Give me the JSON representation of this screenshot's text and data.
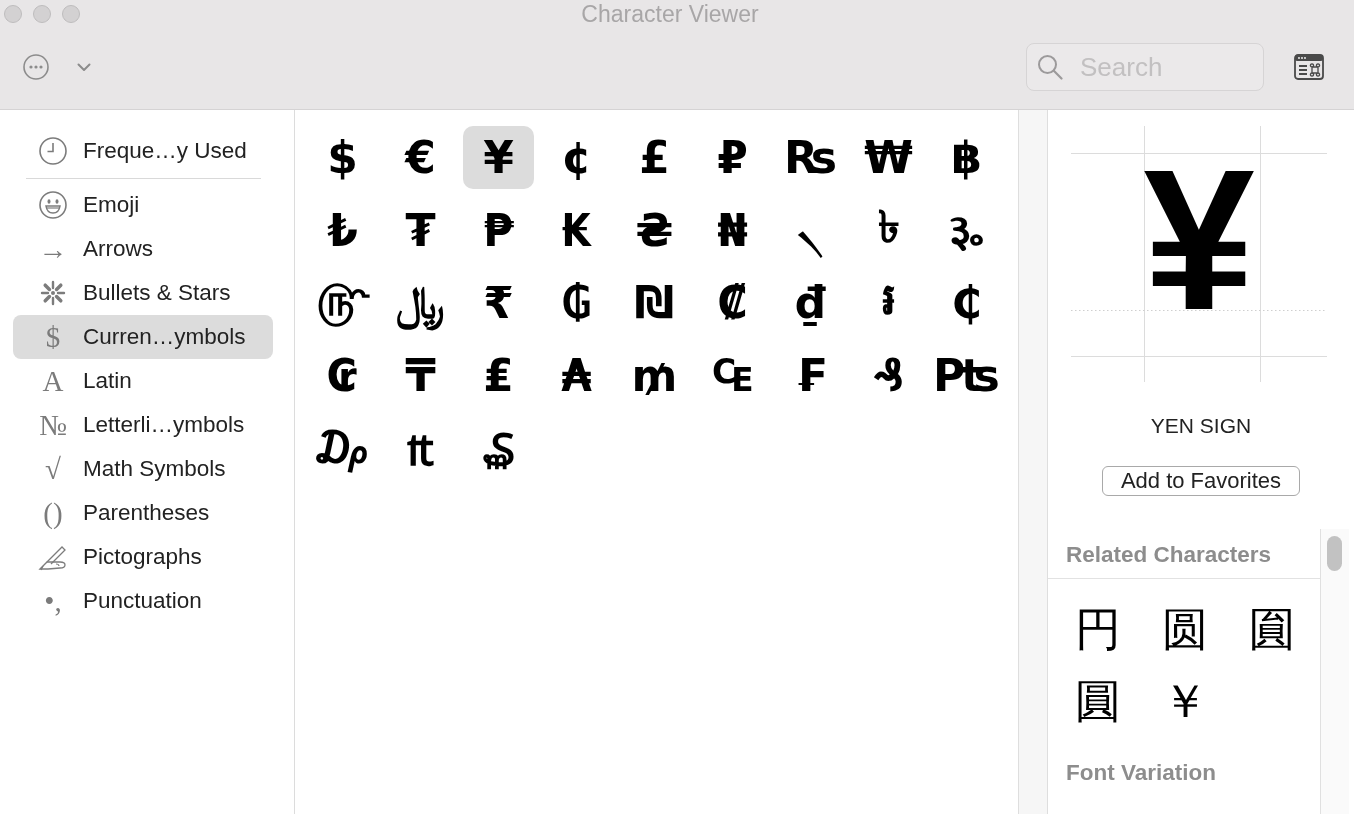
{
  "window": {
    "title": "Character Viewer"
  },
  "toolbar": {
    "search": {
      "placeholder": "Search"
    }
  },
  "sidebar": {
    "sections": [
      {
        "items": [
          {
            "label": "Freque…y Used",
            "selected": false
          }
        ]
      },
      {
        "items": [
          {
            "label": "Emoji",
            "selected": false
          },
          {
            "label": "Arrows",
            "icon": "→",
            "selected": false
          },
          {
            "label": "Bullets & Stars",
            "selected": false
          },
          {
            "label": "Curren…ymbols",
            "icon": "$",
            "selected": true
          },
          {
            "label": "Latin",
            "icon": "A",
            "selected": false
          },
          {
            "label": "Letterli…ymbols",
            "icon": "№",
            "selected": false
          },
          {
            "label": "Math Symbols",
            "icon": "√",
            "selected": false
          },
          {
            "label": "Parentheses",
            "icon": "()",
            "selected": false
          },
          {
            "label": "Pictographs",
            "selected": false
          },
          {
            "label": "Punctuation",
            "icon": "•,",
            "selected": false
          }
        ]
      }
    ]
  },
  "character_grid": {
    "characters": [
      {
        "char": "$",
        "selected": false
      },
      {
        "char": "€",
        "selected": false
      },
      {
        "char": "¥",
        "selected": true
      },
      {
        "char": "¢",
        "selected": false
      },
      {
        "char": "£",
        "selected": false
      },
      {
        "char": "₽",
        "selected": false
      },
      {
        "char": "₨",
        "selected": false
      },
      {
        "char": "₩",
        "selected": false
      },
      {
        "char": "฿",
        "selected": false
      },
      {
        "char": "₺",
        "selected": false
      },
      {
        "char": "₮",
        "selected": false
      },
      {
        "char": "₱",
        "selected": false
      },
      {
        "char": "₭",
        "selected": false
      },
      {
        "char": "₴",
        "selected": false
      },
      {
        "char": "₦",
        "selected": false
      },
      {
        "char": "৲",
        "selected": false
      },
      {
        "char": "৳",
        "selected": false
      },
      {
        "char": "૱",
        "selected": false
      },
      {
        "char": "௹",
        "selected": false
      },
      {
        "char": "﷼",
        "selected": false
      },
      {
        "char": "₹",
        "selected": false
      },
      {
        "char": "₲",
        "selected": false
      },
      {
        "char": "₪",
        "selected": false
      },
      {
        "char": "₡",
        "selected": false
      },
      {
        "char": "₫",
        "selected": false
      },
      {
        "char": "៛",
        "selected": false
      },
      {
        "char": "₵",
        "selected": false
      },
      {
        "char": "₢",
        "selected": false
      },
      {
        "char": "₸",
        "selected": false
      },
      {
        "char": "₤",
        "selected": false
      },
      {
        "char": "₳",
        "selected": false
      },
      {
        "char": "₥",
        "selected": false
      },
      {
        "char": "₠",
        "selected": false
      },
      {
        "char": "₣",
        "selected": false
      },
      {
        "char": "₰",
        "selected": false
      },
      {
        "char": "₧",
        "selected": false
      },
      {
        "char": "₯",
        "selected": false
      },
      {
        "char": "₶",
        "selected": false
      },
      {
        "char": "₷",
        "selected": false
      }
    ]
  },
  "detail": {
    "preview": "¥",
    "name": "YEN SIGN",
    "favorites_button": "Add to Favorites",
    "related_characters": {
      "title": "Related Characters",
      "characters": [
        "円",
        "圆",
        "圎",
        "圓",
        "￥"
      ]
    },
    "font_variation": {
      "title": "Font Variation"
    }
  }
}
